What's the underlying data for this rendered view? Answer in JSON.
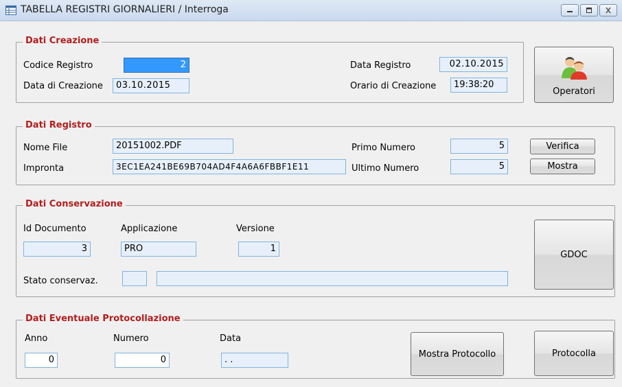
{
  "window": {
    "title": "TABELLA REGISTRI GIORNALIERI / Interroga"
  },
  "dati_creazione": {
    "legend": "Dati Creazione",
    "codice_registro_label": "Codice Registro",
    "codice_registro_value": "2",
    "data_creazione_label": "Data di Creazione",
    "data_creazione_value": "03.10.2015",
    "data_registro_label": "Data Registro",
    "data_registro_value": "02.10.2015",
    "orario_creazione_label": "Orario di Creazione",
    "orario_creazione_value": "19:38:20",
    "operatori_button": "Operatori"
  },
  "dati_registro": {
    "legend": "Dati Registro",
    "nome_file_label": "Nome File",
    "nome_file_value": "20151002.PDF",
    "impronta_label": "Impronta",
    "impronta_value": "3EC1EA241BE69B704AD4F4A6A6FBBF1E11",
    "primo_numero_label": "Primo Numero",
    "primo_numero_value": "5",
    "ultimo_numero_label": "Ultimo Numero",
    "ultimo_numero_value": "5",
    "verifica_button": "Verifica",
    "mostra_button": "Mostra"
  },
  "dati_conservazione": {
    "legend": "Dati Conservazione",
    "id_documento_label": "Id Documento",
    "id_documento_value": "3",
    "applicazione_label": "Applicazione",
    "applicazione_value": "PRO",
    "versione_label": "Versione",
    "versione_value": "1",
    "stato_label": "Stato conservaz.",
    "stato_code_value": "",
    "stato_desc_value": "",
    "gdoc_button": "GDOC"
  },
  "dati_protocollazione": {
    "legend": "Dati Eventuale Protocollazione",
    "anno_label": "Anno",
    "anno_value": "0",
    "numero_label": "Numero",
    "numero_value": "0",
    "data_label": "Data",
    "data_value": ". .",
    "mostra_protocollo_button": "Mostra Protocollo",
    "protocolla_button": "Protocolla"
  },
  "icons": {
    "app": "table-window-icon",
    "minimize": "minimize-icon",
    "maximize": "maximize-icon",
    "close": "close-icon",
    "operators": "users-icon"
  }
}
